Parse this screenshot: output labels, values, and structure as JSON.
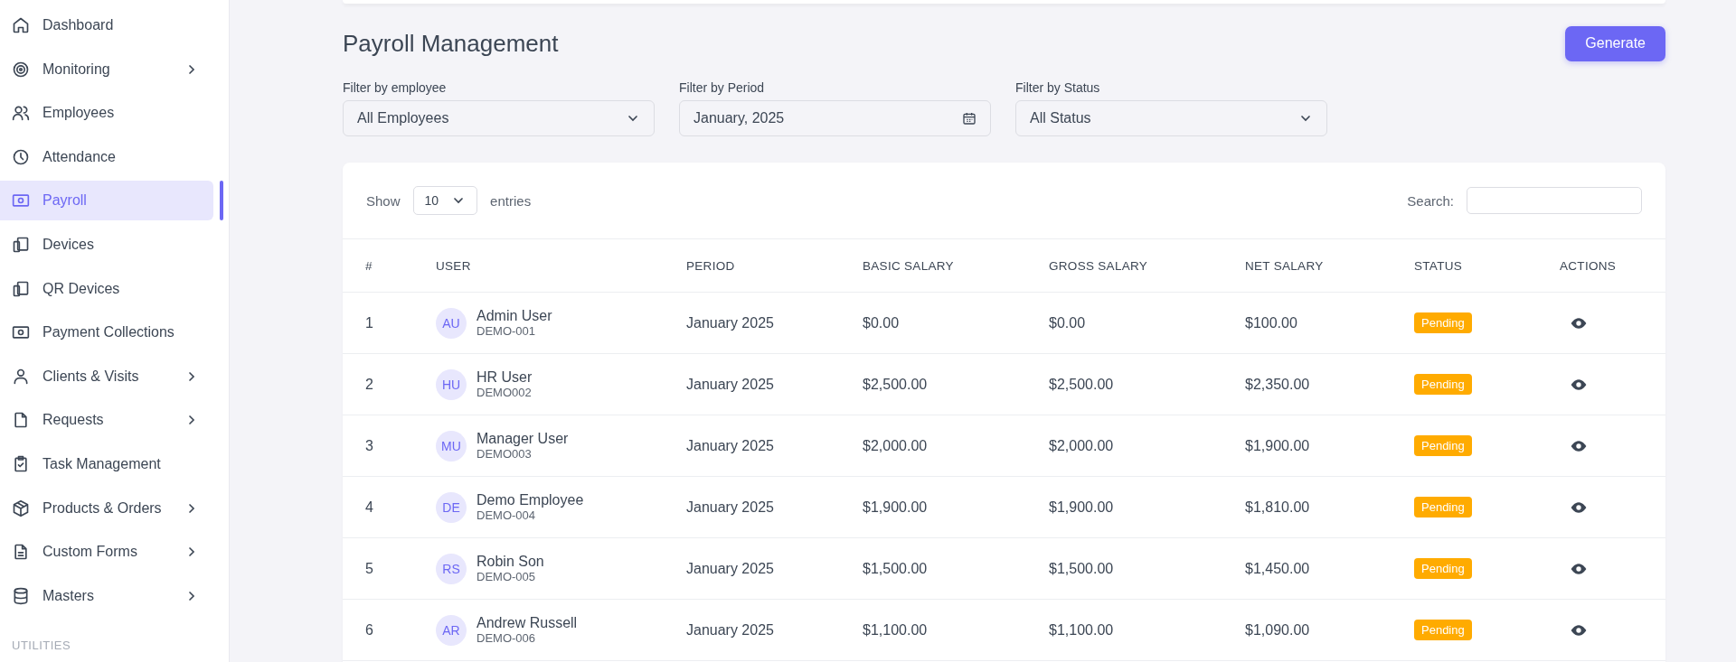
{
  "sidebar": {
    "items": [
      {
        "label": "Dashboard",
        "selected": false,
        "expandable": false
      },
      {
        "label": "Monitoring",
        "selected": false,
        "expandable": true
      },
      {
        "label": "Employees",
        "selected": false,
        "expandable": false
      },
      {
        "label": "Attendance",
        "selected": false,
        "expandable": false
      },
      {
        "label": "Payroll",
        "selected": true,
        "expandable": false
      },
      {
        "label": "Devices",
        "selected": false,
        "expandable": false
      },
      {
        "label": "QR Devices",
        "selected": false,
        "expandable": false
      },
      {
        "label": "Payment Collections",
        "selected": false,
        "expandable": false
      },
      {
        "label": "Clients & Visits",
        "selected": false,
        "expandable": true
      },
      {
        "label": "Requests",
        "selected": false,
        "expandable": true
      },
      {
        "label": "Task Management",
        "selected": false,
        "expandable": false
      },
      {
        "label": "Products & Orders",
        "selected": false,
        "expandable": true
      },
      {
        "label": "Custom Forms",
        "selected": false,
        "expandable": true
      },
      {
        "label": "Masters",
        "selected": false,
        "expandable": true
      }
    ],
    "section_heading": "UTILITIES"
  },
  "page": {
    "title": "Payroll Management",
    "generate_button": "Generate"
  },
  "filters": [
    {
      "label": "Filter by employee",
      "value": "All Employees",
      "kind": "select"
    },
    {
      "label": "Filter by Period",
      "value": "January, 2025",
      "kind": "date"
    },
    {
      "label": "Filter by Status",
      "value": "All Status",
      "kind": "select"
    }
  ],
  "table": {
    "show_label": "Show",
    "page_size": "10",
    "entries_label": "entries",
    "search_label": "Search:",
    "columns": [
      "#",
      "USER",
      "PERIOD",
      "BASIC SALARY",
      "GROSS SALARY",
      "NET SALARY",
      "STATUS",
      "ACTIONS"
    ],
    "rows": [
      {
        "index": "1",
        "initials": "AU",
        "name": "Admin User",
        "code": "DEMO-001",
        "period": "January 2025",
        "basic": "$0.00",
        "gross": "$0.00",
        "net": "$100.00",
        "status": "Pending"
      },
      {
        "index": "2",
        "initials": "HU",
        "name": "HR User",
        "code": "DEMO002",
        "period": "January 2025",
        "basic": "$2,500.00",
        "gross": "$2,500.00",
        "net": "$2,350.00",
        "status": "Pending"
      },
      {
        "index": "3",
        "initials": "MU",
        "name": "Manager User",
        "code": "DEMO003",
        "period": "January 2025",
        "basic": "$2,000.00",
        "gross": "$2,000.00",
        "net": "$1,900.00",
        "status": "Pending"
      },
      {
        "index": "4",
        "initials": "DE",
        "name": "Demo Employee",
        "code": "DEMO-004",
        "period": "January 2025",
        "basic": "$1,900.00",
        "gross": "$1,900.00",
        "net": "$1,810.00",
        "status": "Pending"
      },
      {
        "index": "5",
        "initials": "RS",
        "name": "Robin Son",
        "code": "DEMO-005",
        "period": "January 2025",
        "basic": "$1,500.00",
        "gross": "$1,500.00",
        "net": "$1,450.00",
        "status": "Pending"
      },
      {
        "index": "6",
        "initials": "AR",
        "name": "Andrew Russell",
        "code": "DEMO-006",
        "period": "January 2025",
        "basic": "$1,100.00",
        "gross": "$1,100.00",
        "net": "$1,090.00",
        "status": "Pending"
      }
    ]
  }
}
